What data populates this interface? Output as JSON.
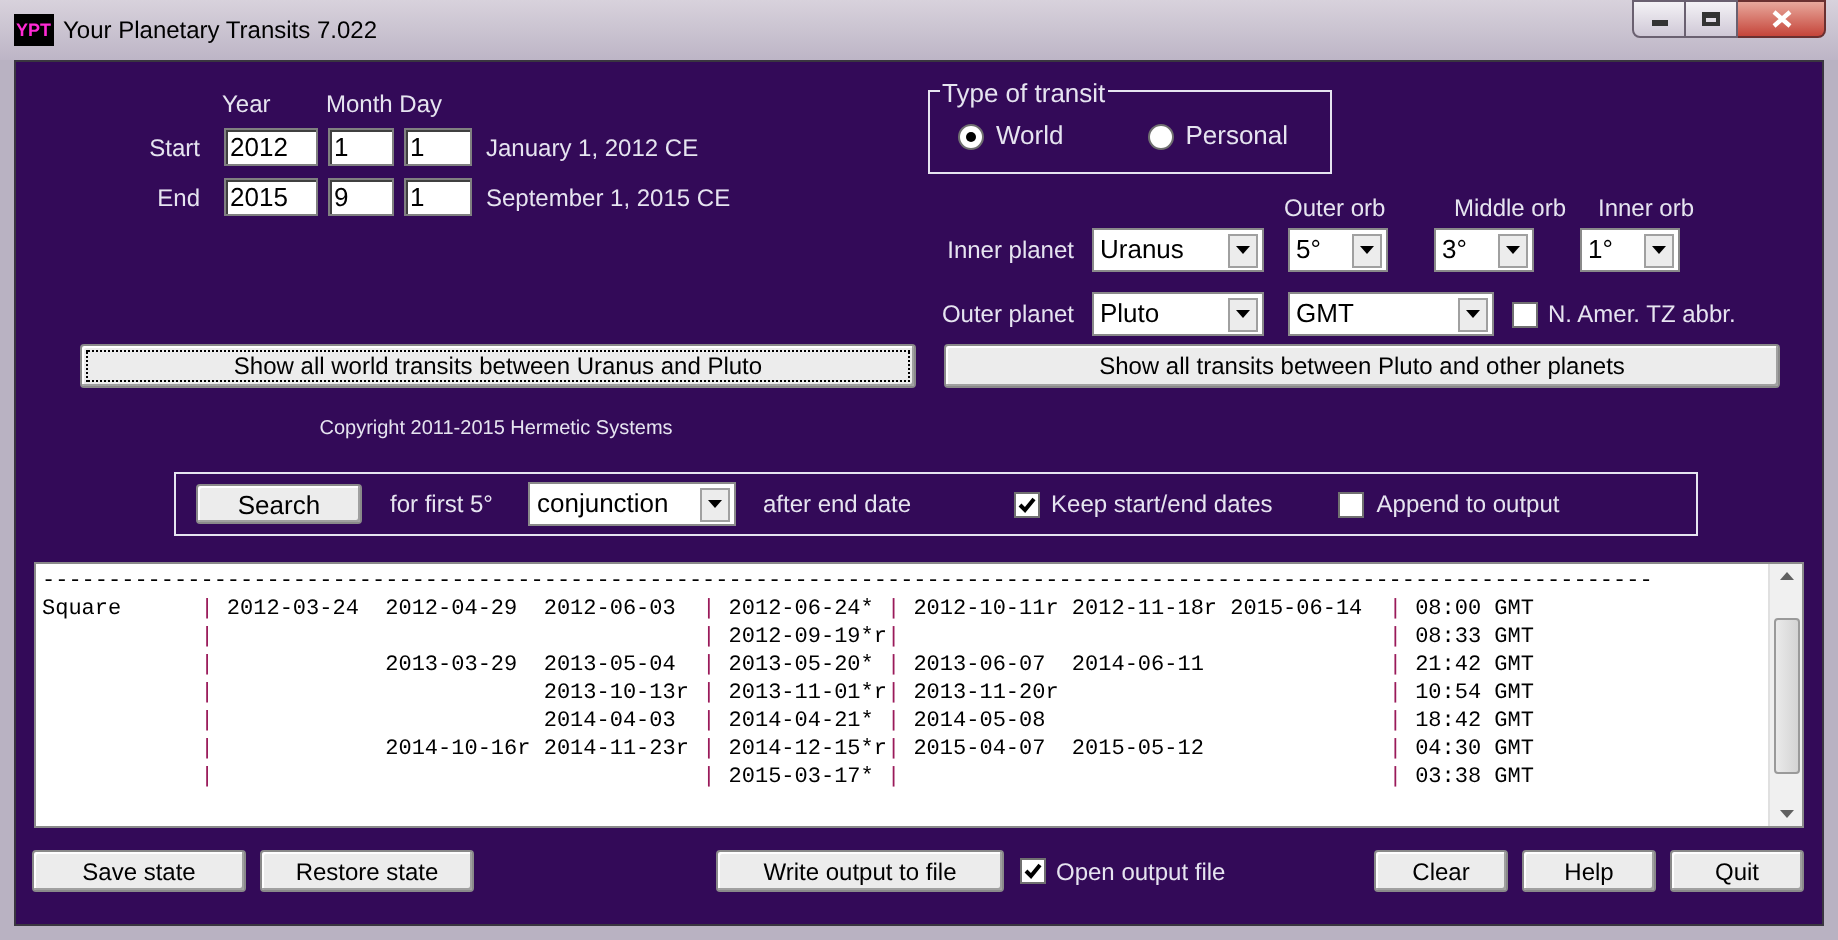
{
  "window": {
    "icon_text": "YPT",
    "title": "Your Planetary Transits 7.022"
  },
  "dates": {
    "headers": [
      "Year",
      "Month Day"
    ],
    "rows": [
      {
        "label": "Start",
        "year": "2012",
        "month": "1",
        "day": "1",
        "text": "January 1, 2012 CE"
      },
      {
        "label": "End",
        "year": "2015",
        "month": "9",
        "day": "1",
        "text": "September 1, 2015 CE"
      }
    ]
  },
  "transit_type": {
    "legend": "Type of transit",
    "options": [
      {
        "label": "World",
        "selected": true
      },
      {
        "label": "Personal",
        "selected": false
      }
    ]
  },
  "orbs": [
    {
      "label": "Outer orb",
      "value": "5°"
    },
    {
      "label": "Middle orb",
      "value": "3°"
    },
    {
      "label": "Inner orb",
      "value": "1°"
    }
  ],
  "planets": {
    "inner_label": "Inner planet",
    "inner": "Uranus",
    "outer_label": "Outer planet",
    "outer": "Pluto",
    "timezone": "GMT",
    "tz_abbr": {
      "label": "N. Amer. TZ abbr.",
      "checked": false
    }
  },
  "show_buttons": [
    {
      "label": "Show all world transits between Uranus and Pluto",
      "focused": true
    },
    {
      "label": "Show all transits between Pluto and other planets",
      "focused": false
    }
  ],
  "copyright": "Copyright 2011-2015 Hermetic Systems",
  "search": {
    "button": "Search",
    "prefix": "for first 5°",
    "aspect": "conjunction",
    "suffix": "after end date",
    "options": [
      {
        "label": "Keep start/end dates",
        "checked": true
      },
      {
        "label": "Append to output",
        "checked": false
      }
    ]
  },
  "output": {
    "lines": [
      "--------------------------------------------------------------------------------------------------------------------------",
      {
        "aspect": "Square",
        "cells": [
          "| 2012-03-24  2012-04-29  2012-06-03  ",
          "| 2012-06-24* ",
          "| 2012-10-11r 2012-11-18r 2015-06-14  ",
          "| 08:00 GMT"
        ]
      },
      {
        "cells": [
          "|                                     ",
          "| 2012-09-19*r",
          "|                                     ",
          "| 08:33 GMT"
        ]
      },
      {
        "cells": [
          "|             2013-03-29  2013-05-04  ",
          "| 2013-05-20* ",
          "| 2013-06-07  2014-06-11              ",
          "| 21:42 GMT"
        ]
      },
      {
        "cells": [
          "|                         2013-10-13r ",
          "| 2013-11-01*r",
          "| 2013-11-20r                         ",
          "| 10:54 GMT"
        ]
      },
      {
        "cells": [
          "|                         2014-04-03  ",
          "| 2014-04-21* ",
          "| 2014-05-08                          ",
          "| 18:42 GMT"
        ]
      },
      {
        "cells": [
          "|             2014-10-16r 2014-11-23r ",
          "| 2014-12-15*r",
          "| 2015-04-07  2015-05-12              ",
          "| 04:30 GMT"
        ]
      },
      {
        "cells": [
          "|                                     ",
          "| 2015-03-17* ",
          "|                                     ",
          "| 03:38 GMT"
        ]
      }
    ]
  },
  "footer": {
    "left": [
      "Save state",
      "Restore state"
    ],
    "write": "Write output to file",
    "open_file": {
      "label": "Open output file",
      "checked": true
    },
    "right": [
      "Clear",
      "Help",
      "Quit"
    ]
  }
}
